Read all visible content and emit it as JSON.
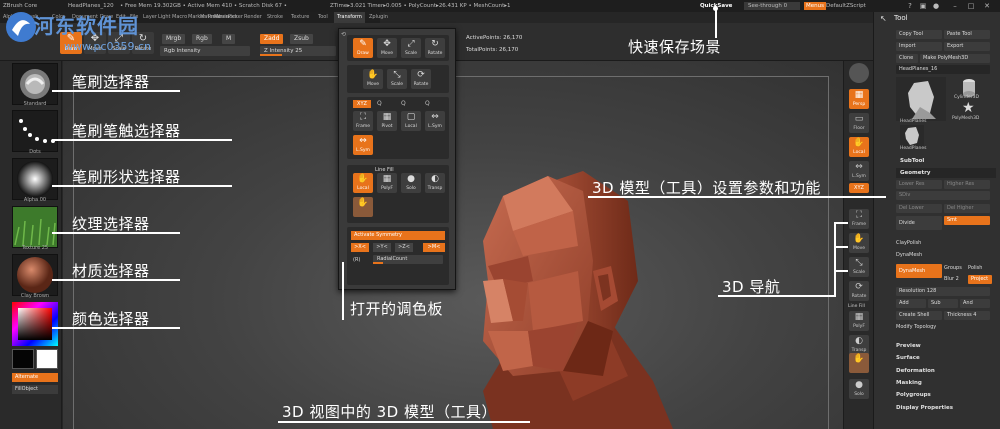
{
  "titlebar": {
    "app": "ZBrush Core",
    "items": [
      "HeadPlanes_120",
      "• Free Mem 19.302GB • Active Mem 410 • Scratch Disk 67 •",
      "ZTime▸3.021 Timer▸0.005 • PolyCount▸26.431 KP • MeshCount▸1"
    ],
    "quicksave": "QuickSave",
    "see_through": "See-through  0",
    "menus": "Menus",
    "script": "DefaultZScript"
  },
  "menubar": {
    "items": [
      "Alpha",
      "Brush",
      "Color",
      "Document",
      "Draw",
      "Edit",
      "File",
      "Layer",
      "Light",
      "Macro",
      "Marker",
      "Material",
      "Movie",
      "Picker",
      "Preferences",
      "Render",
      "Stroke",
      "Texture",
      "Tool",
      "Transform",
      "Zplugin"
    ],
    "active": "Transform"
  },
  "shelf": {
    "buttons": [
      {
        "label": "Draw",
        "glyph": "✎",
        "on": true
      },
      {
        "label": "Move",
        "glyph": "✥",
        "on": false
      },
      {
        "label": "Scale",
        "glyph": "⤢",
        "on": false
      },
      {
        "label": "Rotate",
        "glyph": "↻",
        "on": false
      }
    ],
    "mrgb": "Mrgb",
    "rgb": "Rgb",
    "m": "M",
    "rgb_intensity": "Rgb Intensity",
    "zadd": "Zadd",
    "zsub": "Zsub",
    "z_intensity": "Z Intensity 25",
    "active_points": "ActivePoints: 26,170",
    "total_points": "TotalPoints: 26,170"
  },
  "left_shelf": {
    "items": [
      {
        "label": "Standard"
      },
      {
        "label": "Dots"
      },
      {
        "label": "Alpha 00"
      },
      {
        "label": "Texture 25"
      },
      {
        "label": "Clay Brown"
      }
    ],
    "alternate": "Alternate",
    "fillobject": "FillObject"
  },
  "palette": {
    "top_buttons": [
      "Draw",
      "Move",
      "Scale",
      "Rotate"
    ],
    "mid_buttons": [
      "Move",
      "Scale",
      "Rotate"
    ],
    "axis_buttons": [
      "Frame",
      "Pivot",
      "Local",
      "L.Sym"
    ],
    "line_fill": "Line Fill",
    "floor_buttons": [
      "Local",
      "PolyF",
      "Solo",
      "Transp"
    ],
    "activate_symmetry": "Activate Symmetry",
    "sym_axes": [
      ">X<",
      ">Y<",
      ">Z<",
      ">M<"
    ],
    "radial": "(R)",
    "radial_count": "RadialCount"
  },
  "right_nav": {
    "items": [
      "Persp",
      "Floor",
      "Local",
      "L.Sym",
      "Frame",
      "Move",
      "Scale",
      "Rotate",
      "Line Fill",
      "PolyF",
      "Transp",
      "Solo"
    ]
  },
  "tool_panel": {
    "title": "Tool",
    "buttons": [
      "Copy Tool",
      "Paste Tool",
      "Import",
      "Export",
      "Clone",
      "Make PolyMesh3D"
    ],
    "current": "HeadPlanes_16",
    "thumbs": [
      "HeadPlanes",
      "Cylinder3D",
      "PolyMesh3D",
      "HeadPlanes"
    ],
    "subtool": "SubTool",
    "geometry": "Geometry",
    "geo_buttons": [
      "Lower Res",
      "Higher Res",
      "SDiv",
      "Del Lower",
      "Del Higher",
      "Divide",
      "Smt",
      "ClayPolish",
      "DynaMesh"
    ],
    "dynamesh": "DynaMesh",
    "groups": "Groups",
    "polish": "Polish",
    "blur": "Blur 2",
    "project": "Project",
    "resolution": "Resolution 128",
    "add": "Add",
    "sub": "Sub",
    "and": "And",
    "create_shell": "Create Shell",
    "thickness": "Thickness 4",
    "modify_topology": "Modify Topology",
    "sections": [
      "Preview",
      "Surface",
      "Deformation",
      "Masking",
      "Polygroups",
      "Display Properties"
    ]
  },
  "annotations": {
    "quick_save": "快速保存场景",
    "brush_selector": "笔刷选择器",
    "stroke_selector": "笔刷笔触选择器",
    "alpha_selector": "笔刷形状选择器",
    "texture_selector": "纹理选择器",
    "material_selector": "材质选择器",
    "color_selector": "颜色选择器",
    "open_palette": "打开的调色板",
    "tool_settings": "3D 模型（工具）设置参数和功能",
    "nav_3d": "3D 导航",
    "model_in_view": "3D 视图中的 3D 模型（工具）"
  },
  "watermark": {
    "name": "河东软件园",
    "url": "www.pc0359.cn"
  }
}
